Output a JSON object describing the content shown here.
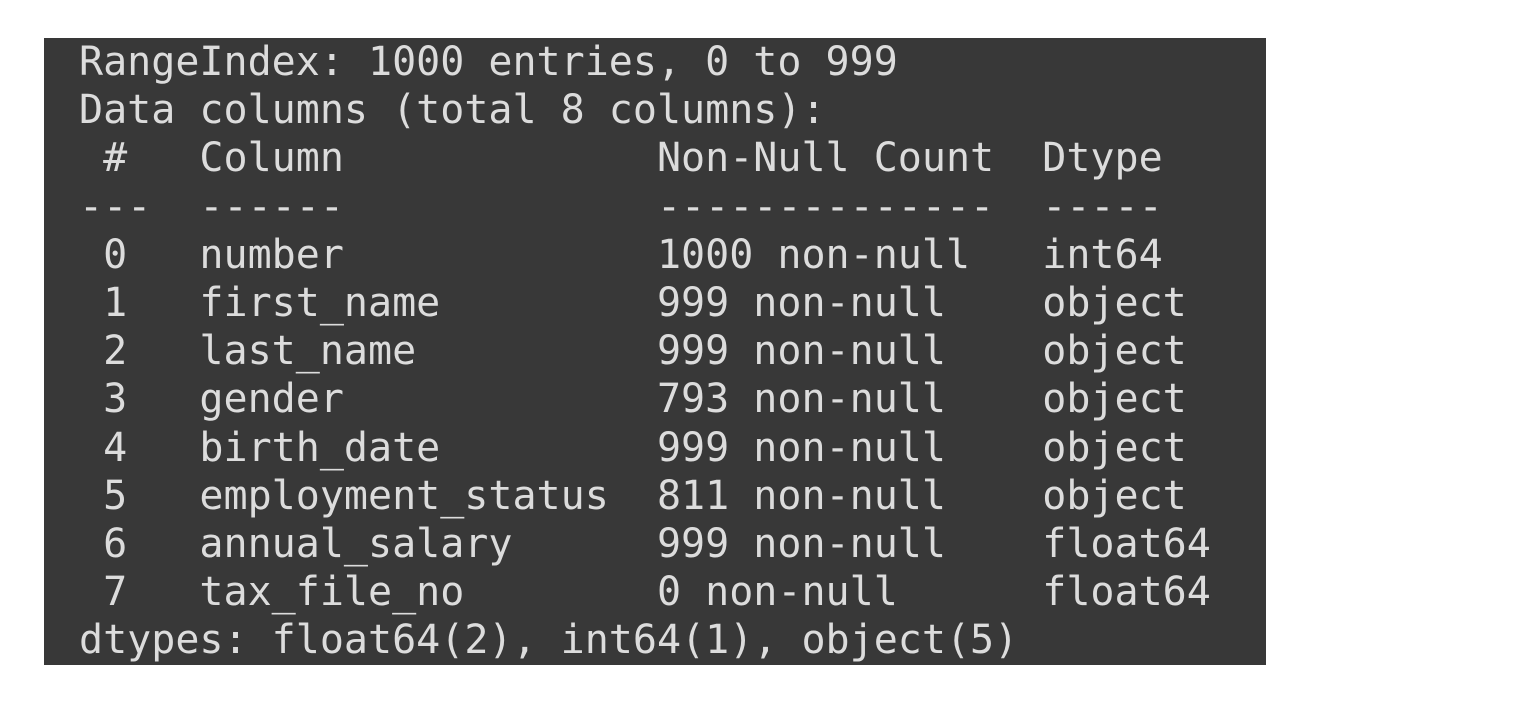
{
  "output": {
    "range_index": "RangeIndex: 1000 entries, 0 to 999",
    "data_columns": "Data columns (total 8 columns):",
    "header": {
      "index": " #",
      "column": "Column",
      "non_null": "Non-Null Count",
      "dtype": "Dtype"
    },
    "separator": {
      "index": "---",
      "column": "------",
      "non_null": "--------------",
      "dtype": "-----"
    },
    "rows": [
      {
        "index": " 0",
        "column": "number",
        "non_null": "1000 non-null",
        "dtype": "int64"
      },
      {
        "index": " 1",
        "column": "first_name",
        "non_null": "999 non-null",
        "dtype": "object"
      },
      {
        "index": " 2",
        "column": "last_name",
        "non_null": "999 non-null",
        "dtype": "object"
      },
      {
        "index": " 3",
        "column": "gender",
        "non_null": "793 non-null",
        "dtype": "object"
      },
      {
        "index": " 4",
        "column": "birth_date",
        "non_null": "999 non-null",
        "dtype": "object"
      },
      {
        "index": " 5",
        "column": "employment_status",
        "non_null": "811 non-null",
        "dtype": "object"
      },
      {
        "index": " 6",
        "column": "annual_salary",
        "non_null": "999 non-null",
        "dtype": "float64"
      },
      {
        "index": " 7",
        "column": "tax_file_no",
        "non_null": "0 non-null",
        "dtype": "float64"
      }
    ],
    "dtypes_summary": "dtypes: float64(2), int64(1), object(5)"
  }
}
